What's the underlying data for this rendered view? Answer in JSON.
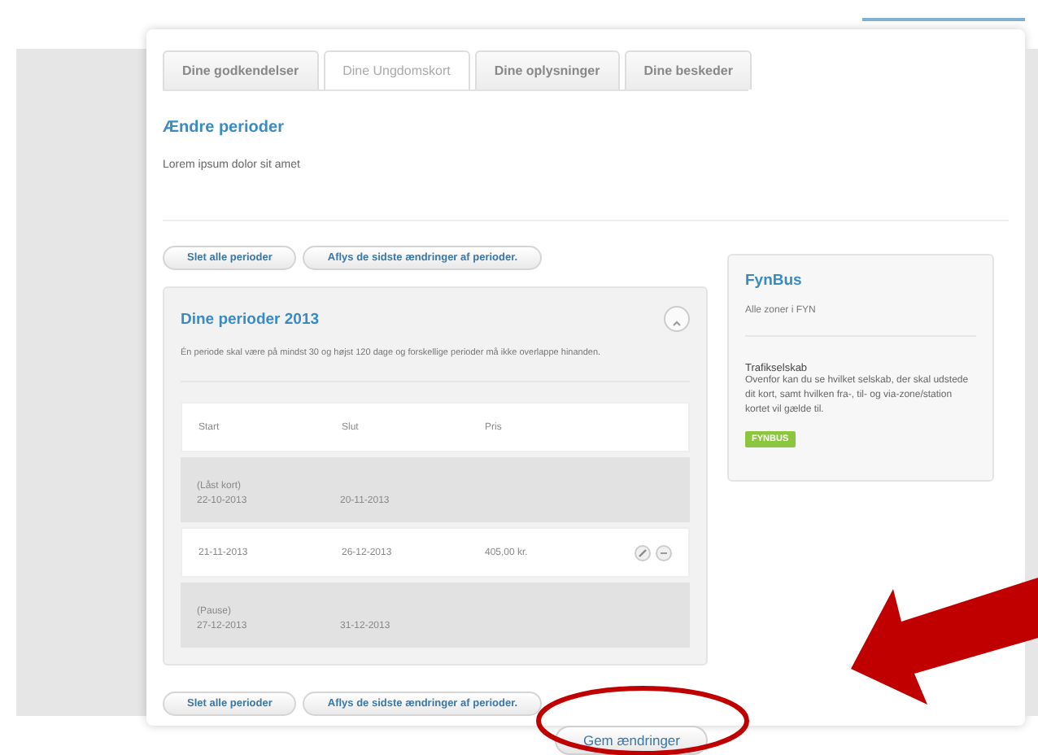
{
  "tabs": [
    {
      "label": "Dine godkendelser",
      "selected": false
    },
    {
      "label": "Dine Ungdomskort",
      "selected": true
    },
    {
      "label": "Dine oplysninger",
      "selected": false
    },
    {
      "label": "Dine beskeder",
      "selected": false
    }
  ],
  "heading": "Ændre perioder",
  "intro": "Lorem ipsum dolor sit amet",
  "top_buttons": [
    "Slet alle perioder",
    "Aflys de sidste ændringer af perioder."
  ],
  "periods": {
    "title": "Dine perioder 2013",
    "note": "Én periode skal være på mindst 30 og højst 120 dage og forskellige perioder må ikke overlappe hinanden.",
    "columns": [
      "Start",
      "Slut",
      "Pris"
    ],
    "rows": [
      {
        "kind": "locked",
        "note": "(Låst kort)",
        "start": "22-10-2013",
        "end": "20-11-2013"
      },
      {
        "kind": "editable",
        "start": "21-11-2013",
        "end": "26-12-2013",
        "price": "405,00 kr."
      },
      {
        "kind": "locked",
        "note": "(Pause)",
        "start": "27-12-2013",
        "end": "31-12-2013"
      }
    ]
  },
  "bottom_buttons": [
    "Slet alle perioder",
    "Aflys de sidste ændringer af perioder."
  ],
  "save_button": "Gem ændringer",
  "sidebar": {
    "title": "FynBus",
    "subtitle": "Alle zoner i FYN",
    "section_title": "Trafikselskab",
    "section_text": "Ovenfor kan du se hvilket selskab, der skal udstede dit kort, samt hvilken fra-, til- og via-zone/station kortet vil gælde til.",
    "badge": "FYNBUS"
  }
}
